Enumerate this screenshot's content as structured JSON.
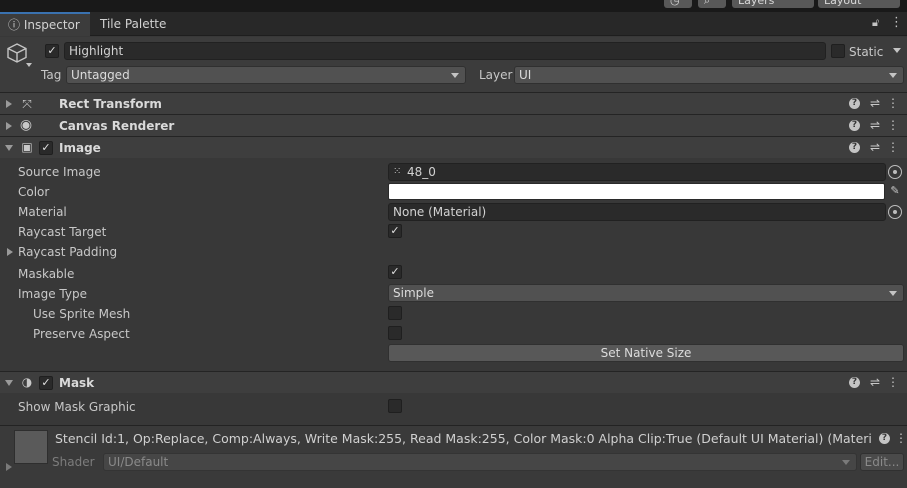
{
  "topbar": {
    "layers_label": "Layers",
    "layout_label": "Layout"
  },
  "tabs": {
    "inspector": "Inspector",
    "tile_palette": "Tile Palette"
  },
  "gameobject": {
    "name": "Highlight",
    "active": true,
    "static_label": "Static",
    "tag_label": "Tag",
    "tag_value": "Untagged",
    "layer_label": "Layer",
    "layer_value": "UI"
  },
  "components": {
    "rect_transform": {
      "title": "Rect Transform"
    },
    "canvas_renderer": {
      "title": "Canvas Renderer"
    },
    "image": {
      "title": "Image",
      "enabled": true,
      "source_image_label": "Source Image",
      "source_image_value": "48_0",
      "color_label": "Color",
      "color_value": "#ffffff",
      "material_label": "Material",
      "material_value": "None (Material)",
      "raycast_target_label": "Raycast Target",
      "raycast_target": true,
      "raycast_padding_label": "Raycast Padding",
      "maskable_label": "Maskable",
      "maskable": true,
      "image_type_label": "Image Type",
      "image_type_value": "Simple",
      "use_sprite_mesh_label": "Use Sprite Mesh",
      "preserve_aspect_label": "Preserve Aspect",
      "set_native_size_label": "Set Native Size"
    },
    "mask": {
      "title": "Mask",
      "enabled": true,
      "show_mask_graphic_label": "Show Mask Graphic"
    }
  },
  "material_preview": {
    "description": "Stencil Id:1, Op:Replace, Comp:Always, Write Mask:255, Read Mask:255, Color Mask:0 Alpha Clip:True (Default UI Material) (Materi",
    "shader_label": "Shader",
    "shader_value": "UI/Default",
    "edit_label": "Edit..."
  },
  "icons": {
    "help": "?",
    "check": "✓",
    "kebab": "⋮"
  },
  "colors": {
    "accent": "#3a72b0",
    "panel": "#383838",
    "header": "#3e3e3e"
  }
}
